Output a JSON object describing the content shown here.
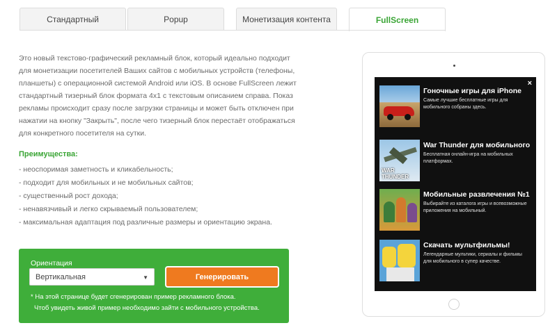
{
  "tabs": [
    {
      "label": "Стандартный",
      "active": false
    },
    {
      "label": "Popup",
      "active": false
    },
    {
      "label": "Монетизация контента",
      "active": false
    },
    {
      "label": "FullScreen",
      "active": true
    }
  ],
  "description": "Это новый текстово-графический рекламный блок, который идеально подходит для монетизации посетителей Ваших сайтов с мобильных устройств (телефоны, планшеты) с операционной системой Android или iOS. В основе FullScreen лежит стандартный тизерный блок формата 4x1 с текстовым описанием справа. Показ рекламы происходит сразу после загрузки страницы и может быть отключен при нажатии на кнопку \"Закрыть\", после чего тизерный блок перестаёт отображаться для конкретного посетителя на сутки.",
  "advantages": {
    "title": "Преимущества:",
    "items": [
      "- неоспоримая заметность и кликабельность;",
      "- подходит для мобильных и не мобильных сайтов;",
      "- существенный рост дохода;",
      "- ненавязчивый и легко скрываемый пользователем;",
      "- максимальная адаптация под различные размеры и ориентацию экрана."
    ]
  },
  "panel": {
    "orientation_label": "Ориентация",
    "orientation_value": "Вертикальная",
    "generate_label": "Генерировать",
    "note1": "* На этой странице будет сгенерирован пример рекламного блока.",
    "note2": "Чтоб увидеть живой пример необходимо зайти с мобильного устройства.",
    "bg_color": "#3fae3a",
    "button_color": "#ef7a1f"
  },
  "preview": {
    "close_glyph": "×",
    "ads": [
      {
        "title": "Гоночные игры для iPhone",
        "text": "Самые лучшие бесплатные игры для мобильного собраны здесь."
      },
      {
        "title": "War Thunder для мобильного",
        "text": "Бесплатная онлайн-игра на мобильных платформах.",
        "thumb_logo": "WAR THUNDER"
      },
      {
        "title": "Мобильные развлечения №1",
        "text": "Выбирайте из каталога игры и всевозможные приложения на мобильный."
      },
      {
        "title": "Скачать мультфильмы!",
        "text": "Легендарные мультики, сериалы и фильмы для мобильного в супер качестве."
      }
    ]
  },
  "colors": {
    "accent": "#3aa535"
  }
}
